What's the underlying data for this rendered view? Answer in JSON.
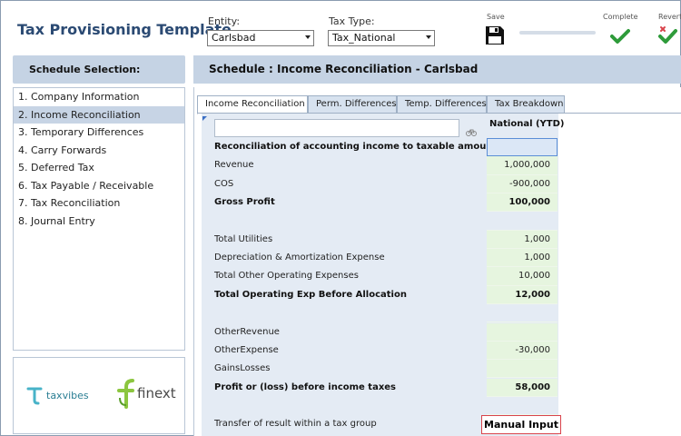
{
  "app": {
    "title": "Tax Provisioning Template"
  },
  "header": {
    "entity": {
      "label": "Entity:",
      "value": "Carlsbad"
    },
    "tax_type": {
      "label": "Tax Type:",
      "value": "Tax_National"
    },
    "save_label": "Save",
    "complete_label": "Complete",
    "revert_label": "Revert",
    "progress_fraction": 0.0
  },
  "sidebar": {
    "title": "Schedule Selection:",
    "items": [
      {
        "label": "1. Company Information",
        "selected": false
      },
      {
        "label": "2. Income Reconciliation",
        "selected": true
      },
      {
        "label": "3. Temporary Differences",
        "selected": false
      },
      {
        "label": "4. Carry Forwards",
        "selected": false
      },
      {
        "label": "5. Deferred Tax",
        "selected": false
      },
      {
        "label": "6. Tax Payable / Receivable",
        "selected": false
      },
      {
        "label": "7. Tax Reconciliation",
        "selected": false
      },
      {
        "label": "8. Journal Entry",
        "selected": false
      }
    ],
    "logos": [
      {
        "text": "taxvibes"
      },
      {
        "text": "finext"
      }
    ]
  },
  "main": {
    "schedule_title": "Schedule : Income Reconciliation - Carlsbad",
    "tabs": [
      {
        "label": "Income Reconciliation",
        "active": true
      },
      {
        "label": "Perm. Differences",
        "active": false
      },
      {
        "label": "Temp. Differences",
        "active": false
      },
      {
        "label": "Tax Breakdown",
        "active": false
      }
    ],
    "grid": {
      "column_header": "National (YTD)",
      "rows": [
        {
          "label": "Reconciliation of accounting income to taxable amount",
          "value": "",
          "bold": true,
          "kind": "selected"
        },
        {
          "label": "Revenue",
          "value": "1,000,000",
          "bold": false,
          "kind": "value"
        },
        {
          "label": "COS",
          "value": "-900,000",
          "bold": false,
          "kind": "value"
        },
        {
          "label": "Gross Profit",
          "value": "100,000",
          "bold": true,
          "kind": "value"
        },
        {
          "label": "",
          "value": "",
          "bold": false,
          "kind": "blank"
        },
        {
          "label": "Total Utilities",
          "value": "1,000",
          "bold": false,
          "kind": "value"
        },
        {
          "label": "Depreciation & Amortization Expense",
          "value": "1,000",
          "bold": false,
          "kind": "value"
        },
        {
          "label": "Total Other Operating Expenses",
          "value": "10,000",
          "bold": false,
          "kind": "value"
        },
        {
          "label": "Total Operating Exp Before Allocation",
          "value": "12,000",
          "bold": true,
          "kind": "value"
        },
        {
          "label": "",
          "value": "",
          "bold": false,
          "kind": "blank"
        },
        {
          "label": "OtherRevenue",
          "value": "",
          "bold": false,
          "kind": "value"
        },
        {
          "label": "OtherExpense",
          "value": "-30,000",
          "bold": false,
          "kind": "value"
        },
        {
          "label": "GainsLosses",
          "value": "",
          "bold": false,
          "kind": "value"
        },
        {
          "label": "Profit or (loss) before income taxes",
          "value": "58,000",
          "bold": true,
          "kind": "value"
        },
        {
          "label": "",
          "value": "",
          "bold": false,
          "kind": "blank"
        },
        {
          "label": "Transfer of result within a tax group",
          "value": "Manual Input",
          "bold": false,
          "kind": "manual"
        }
      ]
    }
  },
  "colors": {
    "title_blue": "#2b4a73",
    "header_band": "#c5d3e4",
    "value_cell": "#e6f5df",
    "check_green": "#2e9b3a",
    "manual_border": "#d9434b"
  }
}
